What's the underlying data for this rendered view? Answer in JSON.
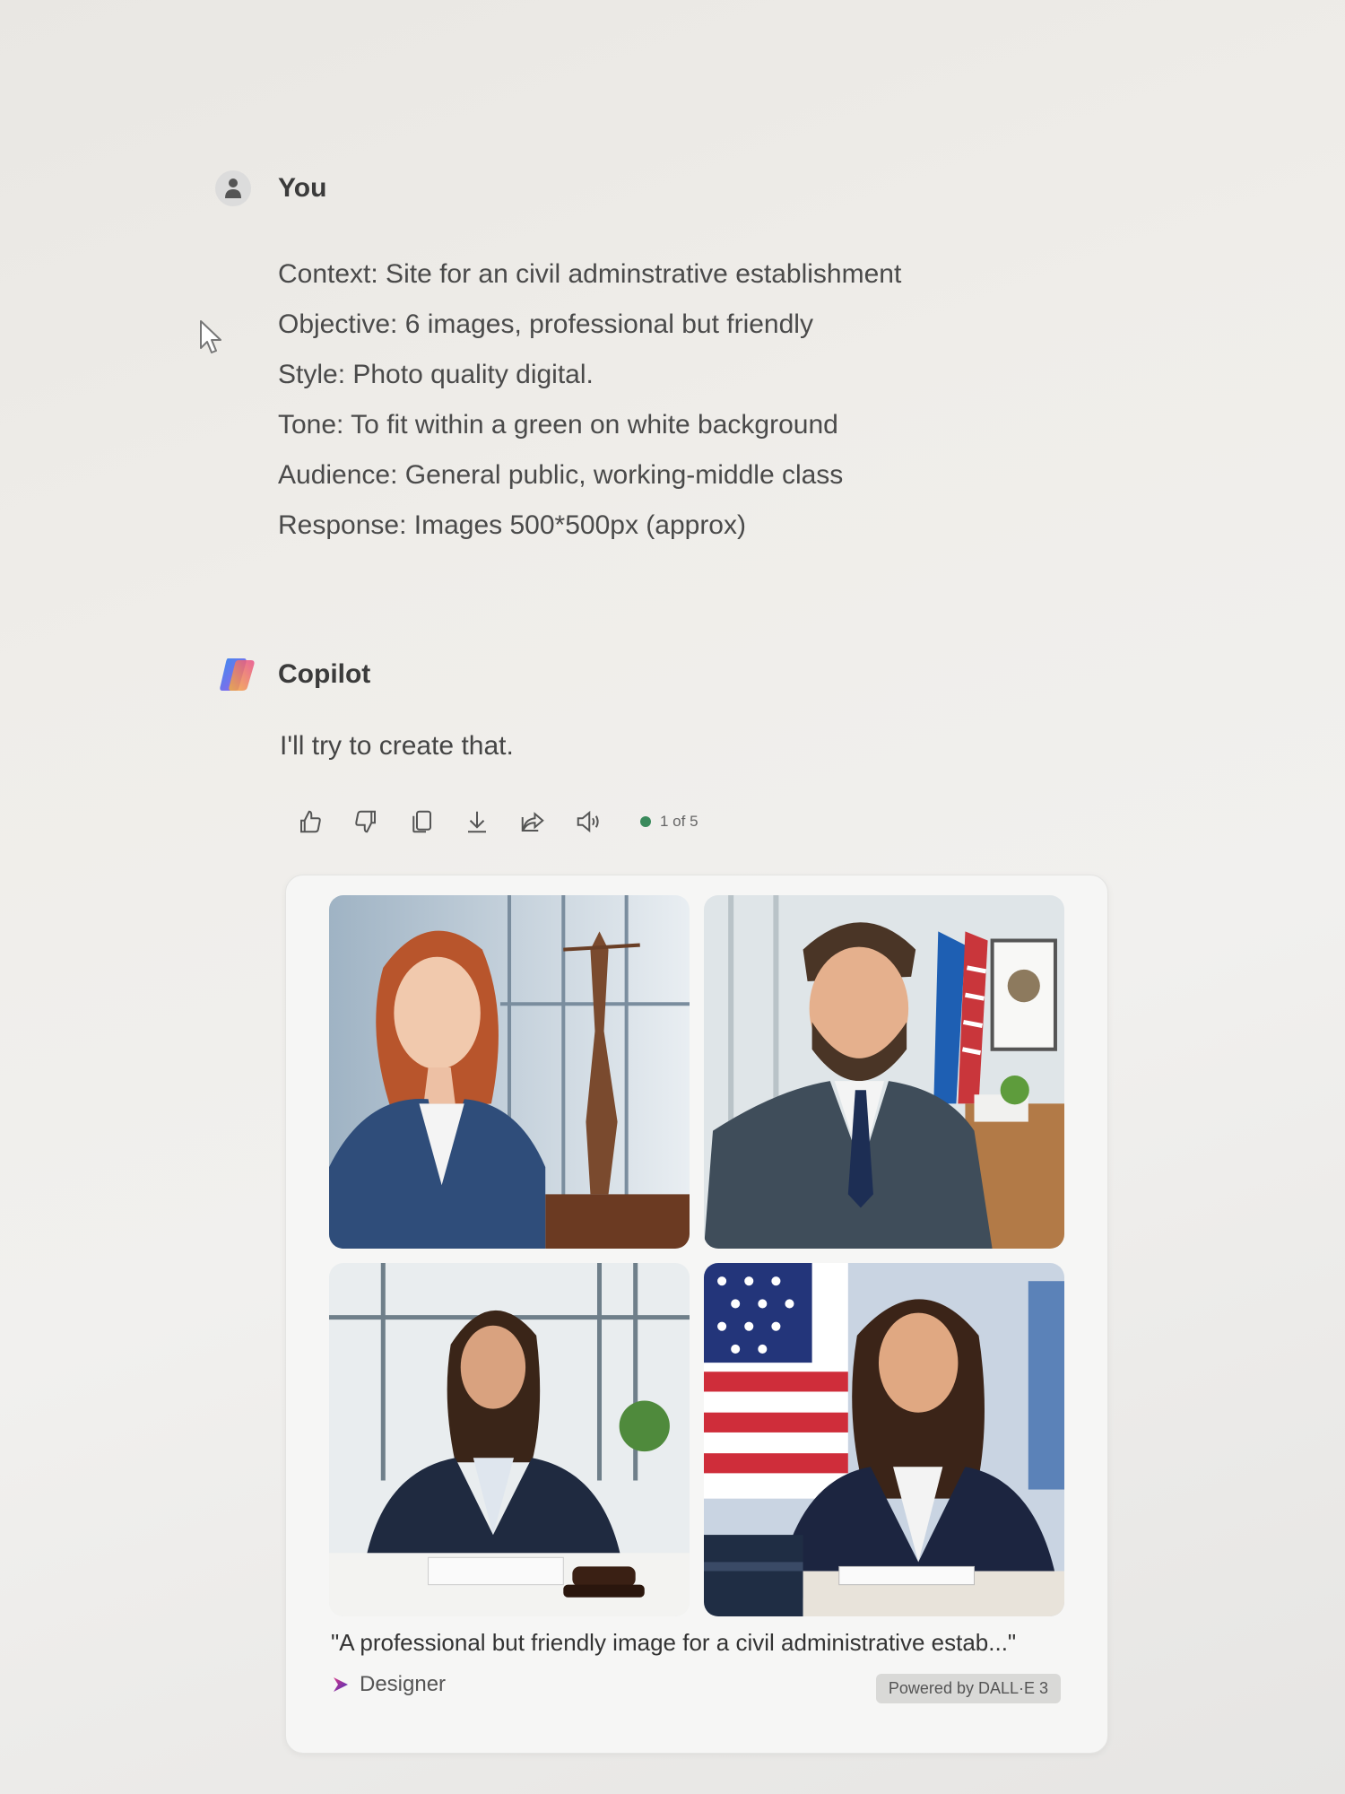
{
  "user": {
    "name": "You",
    "prompt_lines": [
      "Context: Site for an civil adminstrative establishment",
      "Objective: 6 images, professional but friendly",
      "Style: Photo quality digital.",
      "Tone: To fit within a green on white background",
      "Audience: General public, working-middle class",
      "Response: Images 500*500px (approx)"
    ]
  },
  "copilot": {
    "name": "Copilot",
    "reply": "I'll try to create that.",
    "actions": [
      "thumbs-up",
      "thumbs-down",
      "copy",
      "download",
      "share",
      "read-aloud"
    ],
    "pager": "1 of 5",
    "pager_color": "#3a8a5c"
  },
  "image_card": {
    "images": [
      {
        "subject": "woman in blue blazer with justice statue"
      },
      {
        "subject": "bearded man in suit with flags"
      },
      {
        "subject": "woman writing at desk with gavel"
      },
      {
        "subject": "woman at desk with US flag"
      }
    ],
    "caption": "\"A professional but friendly image for a civil administrative estab...\"",
    "designer_label": "Designer",
    "powered_by": "Powered by DALL·E 3"
  }
}
